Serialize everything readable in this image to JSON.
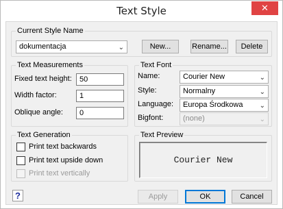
{
  "window": {
    "title": "Text Style",
    "close_icon": "close-icon"
  },
  "current_style": {
    "legend": "Current Style Name",
    "selected": "dokumentacja",
    "new_label": "New...",
    "rename_label": "Rename...",
    "delete_label": "Delete"
  },
  "measurements": {
    "legend": "Text Measurements",
    "fixed_height_label": "Fixed text height:",
    "fixed_height_value": "50",
    "width_factor_label": "Width factor:",
    "width_factor_value": "1",
    "oblique_label": "Oblique angle:",
    "oblique_value": "0"
  },
  "font": {
    "legend": "Text Font",
    "name_label": "Name:",
    "name_value": "Courier New",
    "style_label": "Style:",
    "style_value": "Normalny",
    "language_label": "Language:",
    "language_value": "Europa Środkowa",
    "bigfont_label": "Bigfont:",
    "bigfont_value": "(none)"
  },
  "generation": {
    "legend": "Text Generation",
    "backwards": "Print text backwards",
    "upside_down": "Print text upside down",
    "vertically": "Print text vertically"
  },
  "preview": {
    "legend": "Text Preview",
    "sample": "Courier New"
  },
  "footer": {
    "help": "?",
    "apply": "Apply",
    "ok": "OK",
    "cancel": "Cancel"
  },
  "icons": {
    "dropdown": "chevron-down-icon",
    "help": "help-icon"
  }
}
